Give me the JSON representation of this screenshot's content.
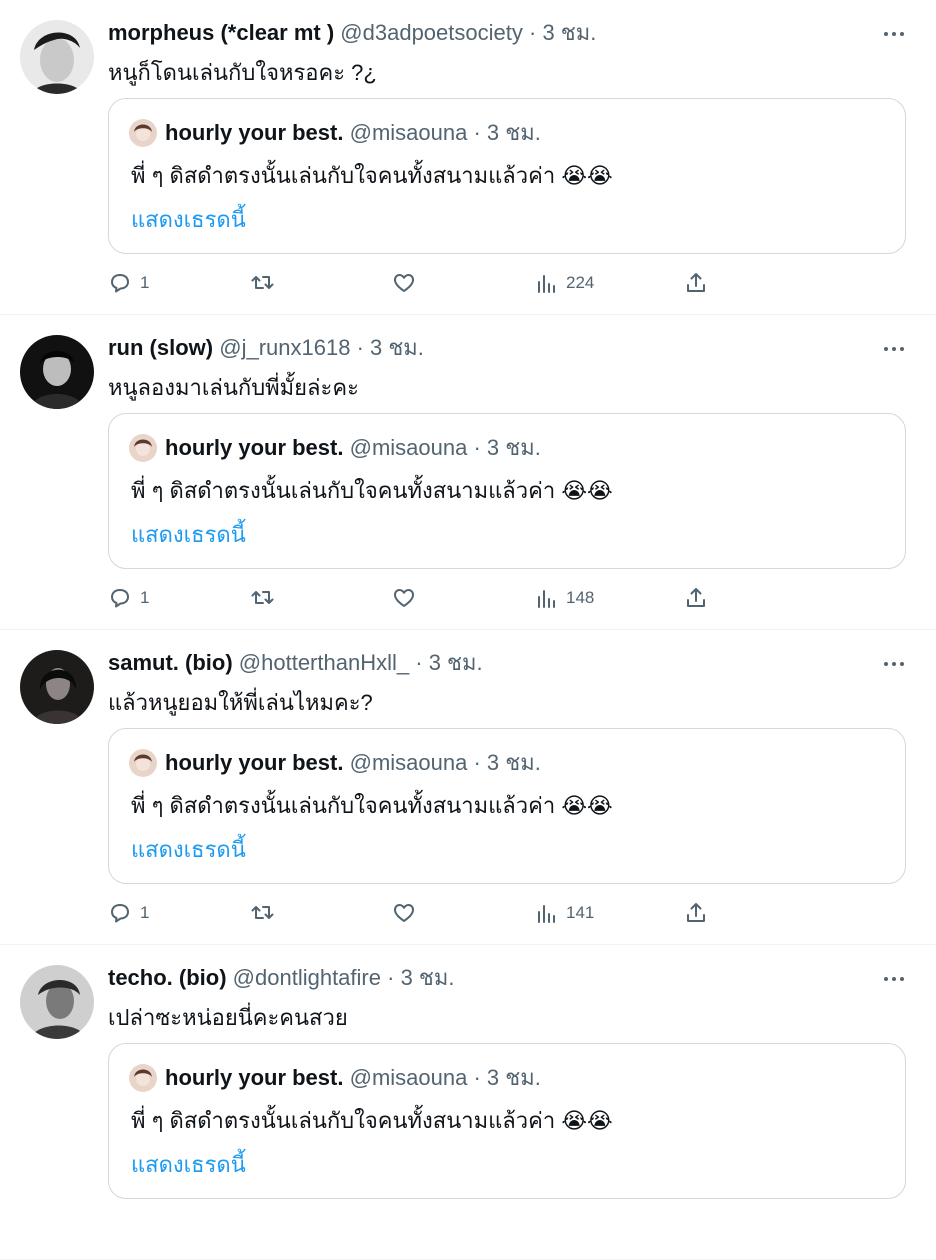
{
  "tweets": [
    {
      "name": "morpheus (*clear mt )",
      "handle": "@d3adpoetsociety",
      "sep": "·",
      "time": "3 ชม.",
      "text": "หนูก็โดนเล่นกับใจหรอคะ ?¿",
      "quote": {
        "name": "hourly your best.",
        "handle": "@misaouna",
        "sep": "·",
        "time": "3 ชม.",
        "text": "พี่ ๆ ดิสดำตรงนั้นเล่นกับใจคนทั้งสนามแล้วค่า",
        "emoji": "😭😭",
        "link": "แสดงเธรดนี้"
      },
      "stats": {
        "replies": "1",
        "retweets": "",
        "likes": "",
        "views": "224"
      }
    },
    {
      "name": "run (slow)",
      "handle": "@j_runx1618",
      "sep": "·",
      "time": "3 ชม.",
      "text": "หนูลองมาเล่นกับพี่มั้ยล่ะคะ",
      "quote": {
        "name": "hourly your best.",
        "handle": "@misaouna",
        "sep": "·",
        "time": "3 ชม.",
        "text": "พี่ ๆ ดิสดำตรงนั้นเล่นกับใจคนทั้งสนามแล้วค่า",
        "emoji": "😭😭",
        "link": "แสดงเธรดนี้"
      },
      "stats": {
        "replies": "1",
        "retweets": "",
        "likes": "",
        "views": "148"
      }
    },
    {
      "name": "samut. (bio)",
      "handle": "@hotterthanHxll_",
      "sep": "·",
      "time": "3 ชม.",
      "text": "แล้วหนูยอมให้พี่เล่นไหมคะ?",
      "quote": {
        "name": "hourly your best.",
        "handle": "@misaouna",
        "sep": "·",
        "time": "3 ชม.",
        "text": "พี่ ๆ ดิสดำตรงนั้นเล่นกับใจคนทั้งสนามแล้วค่า",
        "emoji": "😭😭",
        "link": "แสดงเธรดนี้"
      },
      "stats": {
        "replies": "1",
        "retweets": "",
        "likes": "",
        "views": "141"
      }
    },
    {
      "name": "techo. (bio)",
      "handle": "@dontlightafire",
      "sep": "·",
      "time": "3 ชม.",
      "text": "เปล่าซะหน่อยนี่คะคนสวย",
      "quote": {
        "name": "hourly your best.",
        "handle": "@misaouna",
        "sep": "·",
        "time": "3 ชม.",
        "text": "พี่ ๆ ดิสดำตรงนั้นเล่นกับใจคนทั้งสนามแล้วค่า",
        "emoji": "😭😭",
        "link": "แสดงเธรดนี้"
      },
      "stats": {
        "replies": "",
        "retweets": "",
        "likes": "",
        "views": ""
      }
    }
  ],
  "icons": {
    "more": "more-horizontal-icon",
    "reply": "reply-icon",
    "retweet": "retweet-icon",
    "like": "heart-icon",
    "views": "views-chart-icon",
    "share": "share-icon"
  },
  "colors": {
    "text": "#0f1419",
    "secondary": "#536471",
    "link": "#1d9bf0",
    "border": "#cfd9de"
  }
}
